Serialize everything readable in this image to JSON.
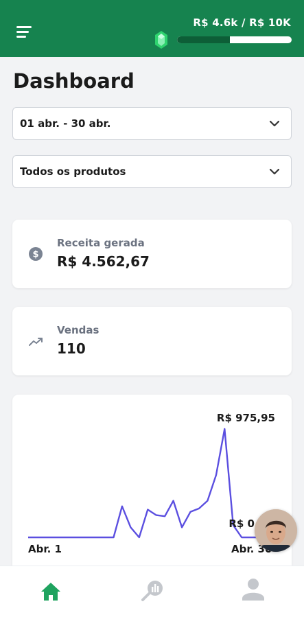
{
  "header": {
    "goal_text": "R$ 4.6k / R$ 10K",
    "progress_fraction": 0.46,
    "brand_color": "#16834f",
    "progress_color": "#0d5e37"
  },
  "page_title": "Dashboard",
  "filters": {
    "date_range": "01 abr. - 30 abr.",
    "product": "Todos os produtos"
  },
  "stats": {
    "revenue": {
      "label": "Receita gerada",
      "value": "R$ 4.562,67",
      "icon": "dollar-coin-icon"
    },
    "sales": {
      "label": "Vendas",
      "value": "110",
      "icon": "trending-up-icon"
    }
  },
  "chart_data": {
    "type": "line",
    "x_start_label": "Abr. 1",
    "x_end_label": "Abr. 30",
    "max_label": "R$ 975,95",
    "min_label": "R$ 0",
    "line_color": "#5b4fe0",
    "values": [
      0,
      0,
      0,
      0,
      0,
      0,
      0,
      0,
      0,
      0,
      0,
      280,
      90,
      0,
      250,
      200,
      190,
      330,
      90,
      230,
      260,
      330,
      560,
      975.95,
      110,
      0,
      0,
      0,
      0,
      0
    ],
    "ylim": [
      0,
      975.95
    ]
  },
  "nav": {
    "active": "home",
    "items": [
      "home-icon",
      "analytics-icon",
      "profile-icon"
    ]
  }
}
